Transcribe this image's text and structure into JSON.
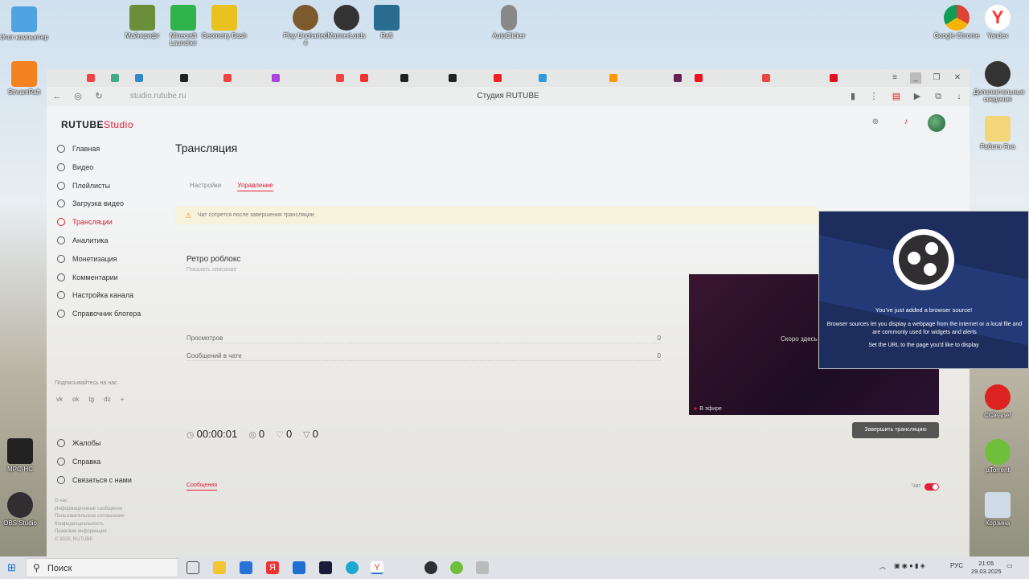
{
  "desktop": {
    "icons": [
      {
        "label": "Этот компьютер"
      },
      {
        "label": "Майнкрафт"
      },
      {
        "label": "Minecraft Launcher"
      },
      {
        "label": "Geometry Dash"
      },
      {
        "label": "Play Uncharted 4"
      },
      {
        "label": "MannerLords"
      },
      {
        "label": "Raft"
      },
      {
        "label": "AutoClicker"
      },
      {
        "label": "Google Chrome"
      },
      {
        "label": "Yandex"
      },
      {
        "label": "StreamRaft"
      },
      {
        "label": "Дополнительные сведения"
      },
      {
        "label": "Работа Яна"
      },
      {
        "label": "CCleaner"
      },
      {
        "label": "µTorrent"
      },
      {
        "label": "Корзина"
      },
      {
        "label": "MPC-HC"
      },
      {
        "label": "OBS Studio"
      }
    ]
  },
  "browser": {
    "window_title": "Студия RUTUBE",
    "url": "studio.rutube.ru"
  },
  "studio": {
    "logo_main": "RUTUBE",
    "logo_sub": "Studio",
    "nav": [
      {
        "label": "Главная",
        "icon": "home-icon"
      },
      {
        "label": "Видео",
        "icon": "video-icon"
      },
      {
        "label": "Плейлисты",
        "icon": "playlist-icon"
      },
      {
        "label": "Загрузка видео",
        "icon": "upload-icon"
      },
      {
        "label": "Трансляции",
        "icon": "broadcast-icon",
        "active": true
      },
      {
        "label": "Аналитика",
        "icon": "analytics-icon"
      },
      {
        "label": "Монетизация",
        "icon": "money-icon"
      },
      {
        "label": "Комментарии",
        "icon": "comment-icon"
      },
      {
        "label": "Настройка канала",
        "icon": "settings-icon"
      },
      {
        "label": "Справочник блогера",
        "icon": "book-icon"
      }
    ],
    "subscribe_label": "Подписывайтесь на нас",
    "socials": [
      "vk",
      "ok",
      "tg",
      "dz",
      "+"
    ],
    "nav2": [
      {
        "label": "Жалобы",
        "icon": "flag-icon"
      },
      {
        "label": "Справка",
        "icon": "help-icon"
      },
      {
        "label": "Связаться с нами",
        "icon": "mail-icon"
      }
    ],
    "footer_links": [
      "О нас",
      "Информационные сообщения",
      "Пользовательское соглашение",
      "Конфиденциальность",
      "Правовая информация",
      "© 2025, RUTUBE"
    ],
    "page_heading": "Трансляция",
    "tabs": [
      {
        "label": "Настройки",
        "active": false
      },
      {
        "label": "Управление",
        "active": true
      }
    ],
    "warning": "Чат сотрется после завершения трансляции",
    "stream_name": "Ретро роблокс",
    "stream_desc": "Показать описание",
    "stats": [
      {
        "label": "Просмотров",
        "value": "0"
      },
      {
        "label": "Сообщений в чате",
        "value": "0"
      }
    ],
    "timer": "00:00:01",
    "viewers": "0",
    "likes": "0",
    "dislikes": "0",
    "messages_tab": "Сообщения",
    "chat_label": "Чат",
    "player_soon": "Скоро здесь начнется трансляция",
    "player_live": "В эфире",
    "end_button": "Завершить трансляцию"
  },
  "obs_popup": {
    "title": "You've just added a browser source!",
    "body": "Browser sources let you display a webpage from the internet or a local file and are commonly used for widgets and alerts",
    "hint": "Set the URL to the page you'd like to display"
  },
  "taskbar": {
    "search_placeholder": "Поиск",
    "lang": "РУС",
    "time": "21:05",
    "date": "29.03.2025"
  }
}
